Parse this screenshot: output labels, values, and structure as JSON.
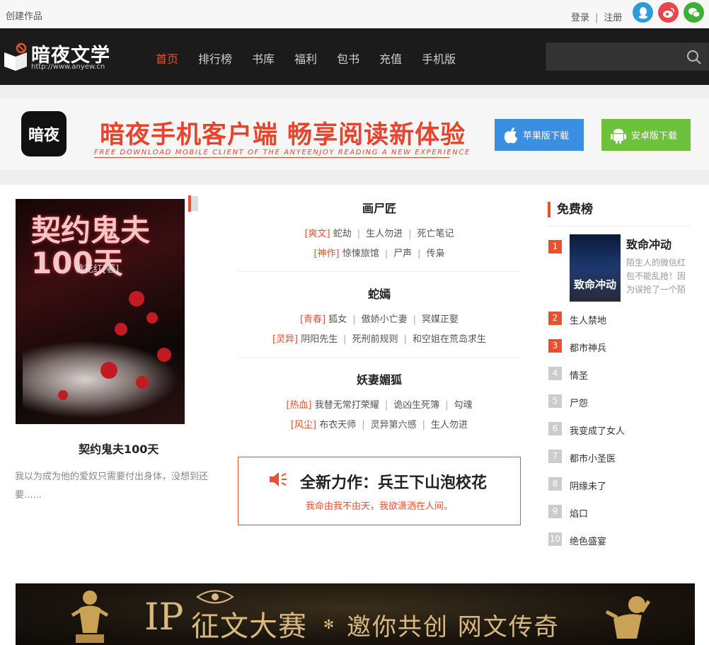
{
  "topbar": {
    "create_label": "创建作品",
    "login_label": "登录",
    "separator": "|",
    "register_label": "注册"
  },
  "header": {
    "brand": "暗夜文学",
    "url": "http://www.anyew.cn",
    "nav": [
      "首页",
      "排行榜",
      "书库",
      "福利",
      "包书",
      "充值",
      "手机版"
    ],
    "search_placeholder": ""
  },
  "banner": {
    "app_logo_text": "暗夜",
    "title": "暗夜手机客户端 畅享阅读新体验",
    "subtitle": "FREE DOWNLOAD MOBILE CLIENT OF THE ANYEENJOY READING A NEW EXPERIENCE",
    "ios_label": "苹果版下载",
    "android_label": "安卓版下载"
  },
  "feature": {
    "cover_title": "契约鬼夫100天",
    "cover_author": "桃花红[著]",
    "name": "契约鬼夫100天",
    "desc": "我以为成为他的爱奴只需要付出身体，没想到还要......"
  },
  "groups": [
    {
      "title": "画尸匠",
      "lines": [
        {
          "tag": "[爽文]",
          "items": [
            "蛇劫",
            "生人勿进",
            "死亡笔记"
          ]
        },
        {
          "tag": "[神作]",
          "items": [
            "惊悚旅馆",
            "尸声",
            "传枭"
          ]
        }
      ]
    },
    {
      "title": "蛇嫣",
      "lines": [
        {
          "tag": "[青春]",
          "items": [
            "狐女",
            "傲娇小亡妻",
            "冥媒正娶"
          ]
        },
        {
          "tag": "[灵异]",
          "items": [
            "阴阳先生",
            "死刑前规则",
            "和空姐在荒岛求生"
          ]
        }
      ]
    },
    {
      "title": "妖妻媚狐",
      "lines": [
        {
          "tag": "[热血]",
          "items": [
            "我替无常打荣耀",
            "诡凶生死簿",
            "勾魂"
          ]
        },
        {
          "tag": "[风尘]",
          "items": [
            "布衣天师",
            "灵异第六感",
            "生人勿进"
          ]
        }
      ]
    }
  ],
  "promo": {
    "title": "全新力作：兵王下山泡校花",
    "subtitle": "我命由我不由天，我欲潇洒在人间。"
  },
  "rank": {
    "title": "免费榜",
    "top": {
      "num": "1",
      "cover_text": "致命冲动",
      "title": "致命冲动",
      "desc": "陌生人的微信红包不能乱抢！因为误抢了一个陌"
    },
    "items": [
      {
        "num": "2",
        "title": "生人禁地",
        "hot": true
      },
      {
        "num": "3",
        "title": "都市神兵",
        "hot": true
      },
      {
        "num": "4",
        "title": "情圣",
        "hot": false
      },
      {
        "num": "5",
        "title": "尸怨",
        "hot": false
      },
      {
        "num": "6",
        "title": "我变成了女人",
        "hot": false
      },
      {
        "num": "7",
        "title": "都市小圣医",
        "hot": false
      },
      {
        "num": "8",
        "title": "阴缘未了",
        "hot": false
      },
      {
        "num": "9",
        "title": "焰口",
        "hot": false
      },
      {
        "num": "10",
        "title": "绝色盛宴",
        "hot": false
      }
    ]
  },
  "ip_banner": {
    "ip": "IP",
    "title": "征文大赛",
    "tagline": "邀你共创  网文传奇"
  },
  "colors": {
    "accent": "#e8502e",
    "header_bg": "#1b1b1b",
    "ios": "#3b8fe0",
    "android": "#6dc23c"
  }
}
